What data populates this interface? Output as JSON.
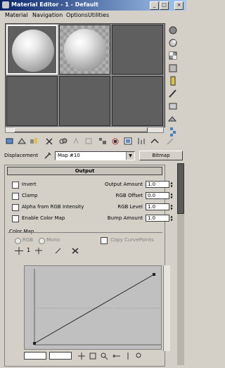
{
  "window": {
    "title": "Material Editor - 1 - Default",
    "controls": {
      "minimize": "_",
      "maximize": "□",
      "close": "×"
    }
  },
  "menubar": {
    "items": [
      "Material",
      "Navigation",
      "Options",
      "Utilities"
    ]
  },
  "toolbar": {
    "buttons": [
      "get-material-icon",
      "put-to-scene-icon",
      "assign-to-selection-icon",
      "reset-map-icon",
      "copy-material-icon",
      "make-unique-icon",
      "put-to-library-icon",
      "material-id-icon",
      "show-map-icon",
      "show-end-result-icon",
      "go-to-parent-icon",
      "go-forward-to-sibling-icon"
    ]
  },
  "displacement": {
    "label": "Displacement",
    "map_value": "Map #10",
    "type_button": "Bitmap"
  },
  "output_rollout": {
    "title": "Output",
    "options": [
      {
        "label": "Invert",
        "checked": false,
        "num_label": "Output Amount",
        "value": "1.0"
      },
      {
        "label": "Clamp",
        "checked": false,
        "num_label": "RGB Offset",
        "value": "0.0"
      },
      {
        "label": "Alpha from RGB Intensity",
        "checked": false,
        "num_label": "RGB Level",
        "value": "1.0"
      },
      {
        "label": "Enable Color Map",
        "checked": false,
        "num_label": "Bump Amount",
        "value": "1.0"
      }
    ],
    "color_map": {
      "label": "Color Map",
      "radio_rgb": "RGB",
      "radio_mono": "Mono",
      "copy_curve_points": "Copy CurvePoints",
      "graph_tool_value": "1"
    }
  },
  "colors": {
    "title_start": "#0a246a",
    "title_end": "#a6caf0",
    "face": "#d4d0c8",
    "slot_empty": "#5f5f5f"
  }
}
